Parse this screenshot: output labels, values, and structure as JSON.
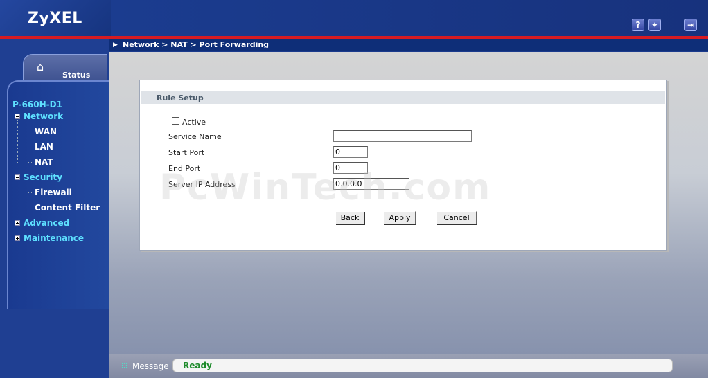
{
  "header": {
    "logo": "ZyXEL",
    "icons": [
      "help-icon",
      "wizard-icon",
      "logout-icon"
    ]
  },
  "breadcrumb": {
    "path": "Network > NAT > Port Forwarding"
  },
  "sidebar": {
    "status_tab": "Status",
    "model": "P-660H-D1",
    "items": [
      {
        "label": "Network",
        "type": "category",
        "expanded": true
      },
      {
        "label": "WAN",
        "type": "child"
      },
      {
        "label": "LAN",
        "type": "child"
      },
      {
        "label": "NAT",
        "type": "child"
      },
      {
        "label": "Security",
        "type": "category",
        "expanded": true
      },
      {
        "label": "Firewall",
        "type": "child"
      },
      {
        "label": "Content Filter",
        "type": "child"
      },
      {
        "label": "Advanced",
        "type": "category",
        "expanded": false
      },
      {
        "label": "Maintenance",
        "type": "category",
        "expanded": false
      }
    ]
  },
  "form": {
    "title": "Rule Setup",
    "active_label": "Active",
    "active_checked": false,
    "service_name_label": "Service Name",
    "service_name_value": "",
    "start_port_label": "Start Port",
    "start_port_value": "0",
    "end_port_label": "End Port",
    "end_port_value": "0",
    "server_ip_label": "Server IP Address",
    "server_ip_value": "0.0.0.0",
    "buttons": {
      "back": "Back",
      "apply": "Apply",
      "cancel": "Cancel"
    }
  },
  "watermark": "PcWinTech.com",
  "message_bar": {
    "label": "Message",
    "value": "Ready"
  },
  "colors": {
    "header_bg": "#1b3c8f",
    "accent_red": "#d71b22",
    "nav_category": "#5ee0ff",
    "status_ready": "#1d8a2a"
  }
}
